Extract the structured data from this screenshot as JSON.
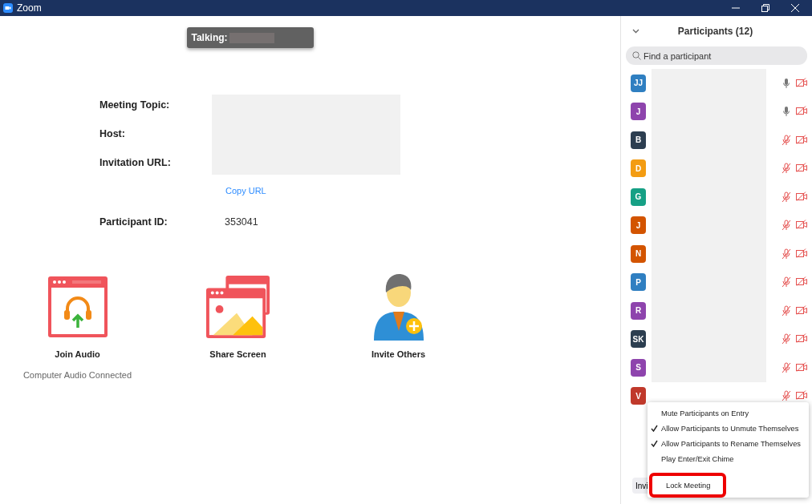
{
  "window": {
    "title": "Zoom"
  },
  "talking": {
    "label": "Talking:"
  },
  "meeting_info": {
    "rows": [
      {
        "label": "Meeting Topic:"
      },
      {
        "label": "Host:"
      },
      {
        "label": "Invitation URL:"
      }
    ],
    "copy_link": "Copy URL",
    "participant_id": {
      "label": "Participant ID:",
      "value": "353041"
    }
  },
  "actions": [
    {
      "kind": "audio",
      "label": "Join Audio",
      "status": "Computer Audio Connected"
    },
    {
      "kind": "share",
      "label": "Share Screen"
    },
    {
      "kind": "invite",
      "label": "Invite Others"
    }
  ],
  "participants_panel": {
    "title": "Participants (12)",
    "search": {
      "placeholder": "Find a participant"
    },
    "participants": [
      {
        "initials": "JJ",
        "color": "#2f7fc1",
        "mic_muted": false,
        "redacted": true
      },
      {
        "initials": "J",
        "color": "#8e44ad",
        "mic_muted": false,
        "redacted": true
      },
      {
        "initials": "B",
        "color": "#2c3e50",
        "mic_muted": true,
        "redacted": true
      },
      {
        "initials": "D",
        "color": "#f39c12",
        "mic_muted": true,
        "redacted": true
      },
      {
        "initials": "G",
        "color": "#16a085",
        "mic_muted": true,
        "redacted": true
      },
      {
        "initials": "J",
        "color": "#d35400",
        "mic_muted": true,
        "redacted": true
      },
      {
        "initials": "N",
        "color": "#d35400",
        "mic_muted": true,
        "redacted": true
      },
      {
        "initials": "P",
        "color": "#2f7fc1",
        "mic_muted": true,
        "redacted": true
      },
      {
        "initials": "R",
        "color": "#8e44ad",
        "mic_muted": true,
        "redacted": true
      },
      {
        "initials": "SK",
        "color": "#2c3e50",
        "mic_muted": true,
        "redacted": true
      },
      {
        "initials": "S",
        "color": "#8e44ad",
        "mic_muted": true,
        "redacted": true
      },
      {
        "initials": "V",
        "color": "#c0392b",
        "mic_muted": true,
        "redacted": false
      }
    ],
    "footer_button": "Invi"
  },
  "more_menu": {
    "items": [
      {
        "label": "Mute Participants on Entry",
        "checked": false,
        "highlighted": false
      },
      {
        "label": "Allow Participants to Unmute Themselves",
        "checked": true,
        "highlighted": false
      },
      {
        "label": "Allow Participants to Rename Themselves",
        "checked": true,
        "highlighted": false
      },
      {
        "label": "Play Enter/Exit Chime",
        "checked": false,
        "highlighted": false
      },
      {
        "label": "Lock Meeting",
        "checked": false,
        "highlighted": true
      }
    ]
  }
}
